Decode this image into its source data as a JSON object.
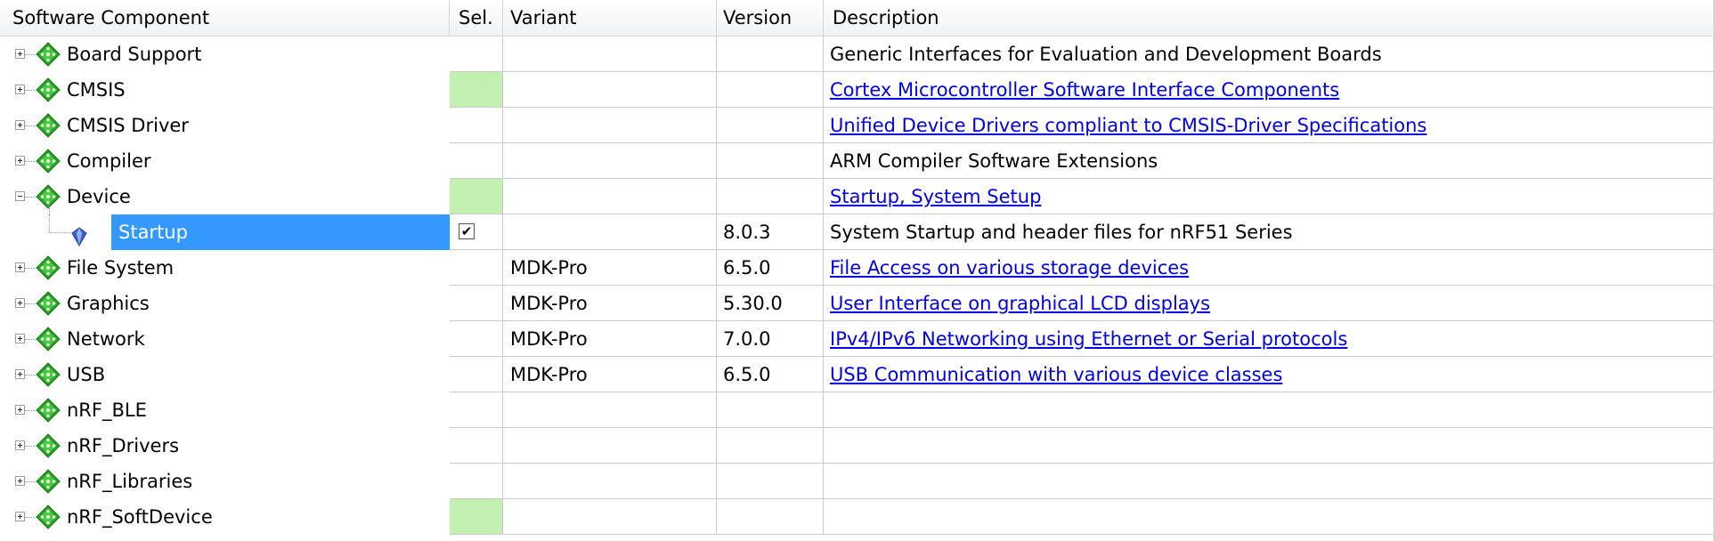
{
  "columns": {
    "component": "Software Component",
    "sel": "Sel.",
    "variant": "Variant",
    "version": "Version",
    "description": "Description"
  },
  "colors": {
    "sel_highlight": "#c2f0b0",
    "selection_blue": "#3399ff",
    "link_blue": "#0000e6",
    "gem_green": "#2aa52a"
  },
  "rows": [
    {
      "name": "Board Support",
      "expand": "plus",
      "icon": "green-gem-icon",
      "sel": "",
      "variant": "",
      "version": "",
      "description": "Generic Interfaces for Evaluation and Development Boards",
      "link": false
    },
    {
      "name": "CMSIS",
      "expand": "plus",
      "icon": "green-gem-icon",
      "sel": "green",
      "variant": "",
      "version": "",
      "description": "Cortex Microcontroller Software Interface Components",
      "link": true
    },
    {
      "name": "CMSIS Driver",
      "expand": "plus",
      "icon": "green-gem-icon",
      "sel": "",
      "variant": "",
      "version": "",
      "description": "Unified Device Drivers compliant to CMSIS-Driver Specifications",
      "link": true
    },
    {
      "name": "Compiler",
      "expand": "plus",
      "icon": "green-gem-icon",
      "sel": "",
      "variant": "",
      "version": "",
      "description": "ARM Compiler Software Extensions",
      "link": false
    },
    {
      "name": "Device",
      "expand": "minus",
      "icon": "green-gem-icon",
      "sel": "green",
      "variant": "",
      "version": "",
      "description": "Startup, System Setup",
      "link": true
    },
    {
      "name": "Startup",
      "expand": "none",
      "icon": "blue-gem-icon",
      "sel": "checked",
      "variant": "",
      "version": "8.0.3",
      "description": "System Startup and header files for nRF51 Series",
      "link": false,
      "selected": true
    },
    {
      "name": "File System",
      "expand": "plus",
      "icon": "green-gem-icon",
      "sel": "",
      "variant": "MDK-Pro",
      "version": "6.5.0",
      "description": "File Access on various storage devices",
      "link": true
    },
    {
      "name": "Graphics",
      "expand": "plus",
      "icon": "green-gem-icon",
      "sel": "",
      "variant": "MDK-Pro",
      "version": "5.30.0",
      "description": "User Interface on graphical LCD displays",
      "link": true
    },
    {
      "name": "Network",
      "expand": "plus",
      "icon": "green-gem-icon",
      "sel": "",
      "variant": "MDK-Pro",
      "version": "7.0.0",
      "description": "IPv4/IPv6 Networking using Ethernet or Serial protocols",
      "link": true
    },
    {
      "name": "USB",
      "expand": "plus",
      "icon": "green-gem-icon",
      "sel": "",
      "variant": "MDK-Pro",
      "version": "6.5.0",
      "description": "USB Communication with various device classes",
      "link": true
    },
    {
      "name": "nRF_BLE",
      "expand": "plus",
      "icon": "green-gem-icon",
      "sel": "",
      "variant": "",
      "version": "",
      "description": "",
      "link": false
    },
    {
      "name": "nRF_Drivers",
      "expand": "plus",
      "icon": "green-gem-icon",
      "sel": "",
      "variant": "",
      "version": "",
      "description": "",
      "link": false
    },
    {
      "name": "nRF_Libraries",
      "expand": "plus",
      "icon": "green-gem-icon",
      "sel": "",
      "variant": "",
      "version": "",
      "description": "",
      "link": false
    },
    {
      "name": "nRF_SoftDevice",
      "expand": "plus",
      "icon": "green-gem-icon",
      "sel": "green",
      "variant": "",
      "version": "",
      "description": "",
      "link": false
    }
  ]
}
